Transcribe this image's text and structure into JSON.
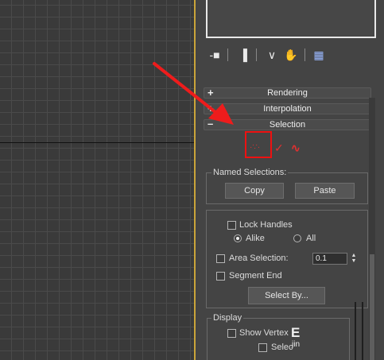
{
  "viewport": {
    "name": "perspective-viewport"
  },
  "toolbar": {
    "icons": [
      "pin-icon",
      "show-end-result-icon",
      "make-unique-icon",
      "remove-modifier-icon",
      "configure-sets-icon"
    ],
    "glyphs": [
      "-■",
      "▐",
      "∨",
      "✋",
      "▦"
    ]
  },
  "rollouts": {
    "rendering": {
      "sign": "+",
      "title": "Rendering"
    },
    "interpolation": {
      "sign": "+",
      "title": "Interpolation"
    },
    "selection": {
      "sign": "–",
      "title": "Selection"
    }
  },
  "subobject": {
    "vertex": "·∵·",
    "segment": "✓",
    "spline": "∿"
  },
  "named_selections": {
    "label": "Named Selections:",
    "copy": "Copy",
    "paste": "Paste"
  },
  "options": {
    "lock_handles": "Lock Handles",
    "alike": "Alike",
    "all": "All",
    "area_selection": "Area Selection:",
    "area_value": "0.1",
    "segment_end": "Segment End",
    "select_by": "Select By..."
  },
  "display": {
    "label": "Display",
    "show_vertex": "Show Vertex",
    "selected": "Selec"
  },
  "watermark": {
    "text": "E",
    "sub": "jin"
  },
  "colors": {
    "accent_red": "#e11111",
    "viewport_border": "#caa43a"
  }
}
